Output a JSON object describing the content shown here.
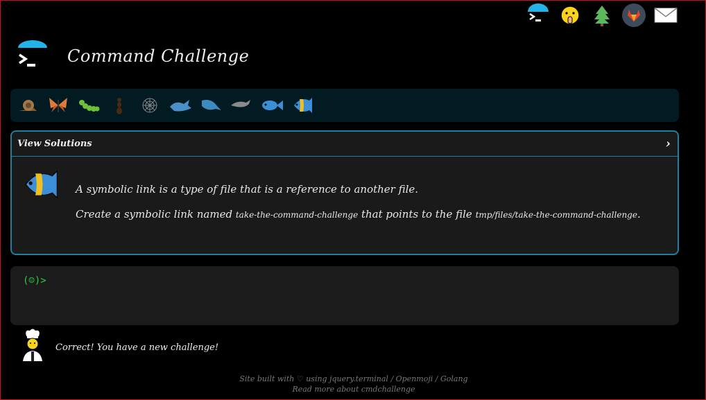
{
  "nav_icons": [
    {
      "name": "terminal-icon"
    },
    {
      "name": "shush-face-icon"
    },
    {
      "name": "tree-icon"
    },
    {
      "name": "gitlab-icon"
    },
    {
      "name": "mail-icon"
    }
  ],
  "header": {
    "title": "Command Challenge"
  },
  "levels": [
    "snail",
    "butterfly",
    "caterpillar",
    "ant",
    "spider-web",
    "whale",
    "whale",
    "dolphin",
    "fish",
    "tropical-fish"
  ],
  "challenge": {
    "view_solutions": "View Solutions",
    "chevron": "›",
    "line1": "A symbolic link is a type of file that is a reference to another file.",
    "line2_pre": "Create a symbolic link named ",
    "line2_code1": "take-the-command-challenge",
    "line2_mid": " that points to the file ",
    "line2_code2": "tmp/files/take-the-command-challenge",
    "line2_post": "."
  },
  "terminal": {
    "prompt": "(☺)>"
  },
  "status": {
    "message": "Correct! You have a new challenge!"
  },
  "footer": {
    "line1": "Site built with ♡ using jquery.terminal / Openmoji / Golang",
    "line2": "Read more about cmdchallenge"
  },
  "colors": {
    "accent": "#1f7fa0",
    "prompt": "#2ecc40",
    "border": "#c0141c"
  }
}
